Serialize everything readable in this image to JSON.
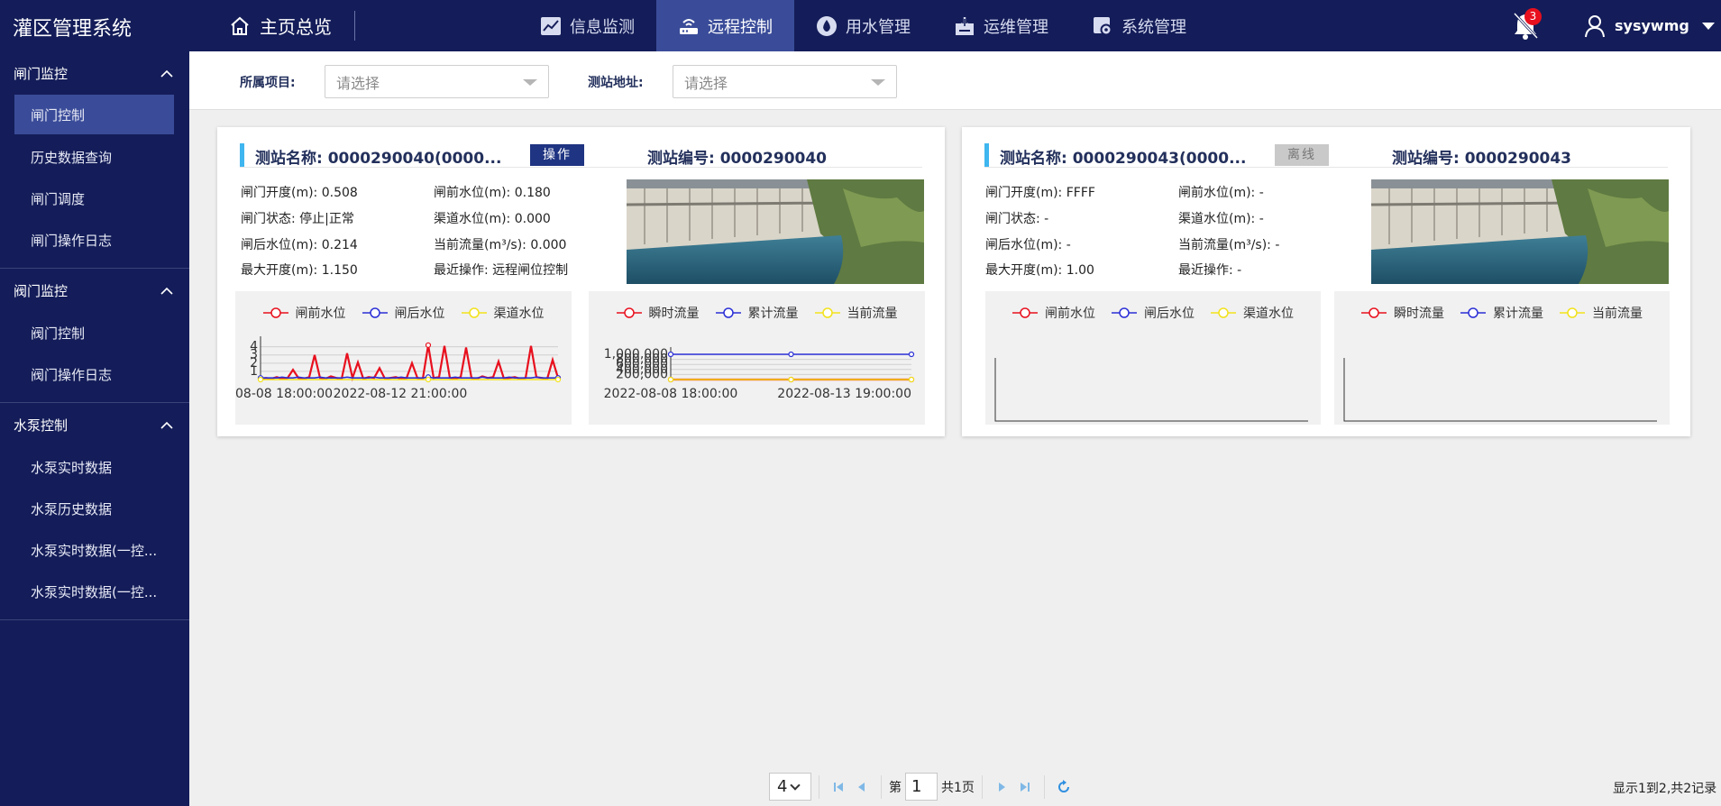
{
  "app": {
    "title": "灌区管理系统",
    "home_label": "主页总览"
  },
  "nav": [
    {
      "label": "信息监测",
      "icon": "chart-line-icon",
      "active": false
    },
    {
      "label": "远程控制",
      "icon": "router-icon",
      "active": true
    },
    {
      "label": "用水管理",
      "icon": "water-drop-icon",
      "active": false
    },
    {
      "label": "运维管理",
      "icon": "maintenance-icon",
      "active": false
    },
    {
      "label": "系统管理",
      "icon": "system-settings-icon",
      "active": false
    }
  ],
  "notifications": {
    "count": "3"
  },
  "user": {
    "name": "sysywmg"
  },
  "sidebar": {
    "groups": [
      {
        "title": "闸门监控",
        "items": [
          "闸门控制",
          "历史数据查询",
          "闸门调度",
          "闸门操作日志"
        ]
      },
      {
        "title": "阀门监控",
        "items": [
          "阀门控制",
          "阀门操作日志"
        ]
      },
      {
        "title": "水泵控制",
        "items": [
          "水泵实时数据",
          "水泵历史数据",
          "水泵实时数据(一控...",
          "水泵实时数据(一控..."
        ]
      }
    ],
    "active_item": "闸门控制"
  },
  "filters": {
    "project_label": "所属项目:",
    "project_placeholder": "请选择",
    "station_label": "测站地址:",
    "station_placeholder": "请选择"
  },
  "cards": [
    {
      "name_label": "测站名称: 0000290040(0000...",
      "button": "操作",
      "online": true,
      "code_label": "测站编号: 0000290040",
      "info": {
        "gate_open": "闸门开度(m): 0.508",
        "front_level": "闸前水位(m): 0.180",
        "gate_status": "闸门状态: 停止|正常",
        "channel_level": "渠道水位(m): 0.000",
        "rear_level": "闸后水位(m): 0.214",
        "flow": "当前流量(m³/s): 0.000",
        "max_open": "最大开度(m): 1.150",
        "last_op": "最近操作: 远程闸位控制"
      },
      "chart1": {
        "legend": [
          "闸前水位",
          "闸后水位",
          "渠道水位"
        ],
        "yticks": [
          "4",
          "3",
          "2",
          "1"
        ],
        "xticks": [
          "08-08 18:00:00",
          "2022-08-12 21:00:00"
        ]
      },
      "chart2": {
        "legend": [
          "瞬时流量",
          "累计流量",
          "当前流量"
        ],
        "yticks": [
          "1,000,000",
          "800,000",
          "600,000",
          "400,000",
          "200,000"
        ],
        "xticks": [
          "2022-08-08 18:00:00",
          "2022-08-13 19:00:00"
        ]
      }
    },
    {
      "name_label": "测站名称: 0000290043(0000...",
      "button": "离线",
      "online": false,
      "code_label": "测站编号: 0000290043",
      "info": {
        "gate_open": "闸门开度(m): FFFF",
        "front_level": "闸前水位(m): -",
        "gate_status": "闸门状态: -",
        "channel_level": "渠道水位(m): -",
        "rear_level": "闸后水位(m): -",
        "flow": "当前流量(m³/s): -",
        "max_open": "最大开度(m): 1.00",
        "last_op": "最近操作: -"
      },
      "chart1": {
        "legend": [
          "闸前水位",
          "闸后水位",
          "渠道水位"
        ]
      },
      "chart2": {
        "legend": [
          "瞬时流量",
          "累计流量",
          "当前流量"
        ]
      }
    }
  ],
  "chart_data": [
    {
      "type": "line",
      "x": [
        "2022-08-08 18:00:00",
        "2022-08-12 21:00:00"
      ],
      "yticks": [
        1,
        2,
        3,
        4
      ],
      "series": [
        {
          "name": "闸前水位",
          "color": "#e8101e",
          "values": [
            0.1,
            0.2,
            0.1,
            0.3,
            0.1,
            0.2,
            1.2,
            0.2,
            0.1,
            0.3,
            3.0,
            0.2,
            0.1,
            0.4,
            0.2,
            0.1,
            3.2,
            0.2,
            2.1,
            0.1,
            0.3,
            0.2,
            1.4,
            0.1,
            0.2,
            0.3,
            0.1,
            0.2,
            2.0,
            0.2,
            0.1,
            4.2,
            0.2,
            0.3,
            4.1,
            0.2,
            0.1,
            0.3,
            3.9,
            0.2,
            0.1,
            0.4,
            0.2,
            0.3,
            2.2,
            0.1,
            0.2,
            0.3,
            0.1,
            0.2,
            4.1,
            0.3,
            0.2,
            0.1,
            2.4,
            0.2
          ]
        },
        {
          "name": "闸后水位",
          "color": "#2b2fd6",
          "values": [
            0.2,
            0.2,
            0.2,
            0.2,
            0.3,
            0.2,
            0.2,
            0.3,
            0.2,
            0.2,
            0.2,
            0.3,
            0.2,
            0.2,
            0.2,
            0.2,
            0.3,
            0.2,
            0.2,
            0.2,
            0.2,
            0.3,
            0.2,
            0.2,
            0.2,
            0.2,
            0.3,
            0.2,
            0.2,
            0.2,
            0.2,
            0.3,
            0.2,
            0.2,
            0.2,
            0.2,
            0.3,
            0.2,
            0.2,
            0.2,
            0.2,
            0.3,
            0.2,
            0.2,
            0.2,
            0.2,
            0.3,
            0.2,
            0.2,
            0.2,
            0.2,
            0.3,
            0.2,
            0.2,
            0.2,
            0.2
          ]
        },
        {
          "name": "渠道水位",
          "color": "#f2e21a",
          "values": [
            0,
            0,
            0,
            0,
            0,
            0,
            0,
            0,
            0,
            0,
            0,
            0,
            0,
            0,
            0,
            0,
            0,
            0,
            0,
            0,
            0,
            0,
            0,
            0,
            0,
            0,
            0,
            0,
            0,
            0,
            0,
            0,
            0,
            0,
            0,
            0,
            0,
            0,
            0,
            0,
            0,
            0,
            0,
            0,
            0,
            0,
            0,
            0,
            0,
            0,
            0,
            0,
            0,
            0,
            0,
            0
          ]
        }
      ]
    },
    {
      "type": "line",
      "x": [
        "2022-08-08 18:00:00",
        "2022-08-13 19:00:00"
      ],
      "yticks": [
        200000,
        400000,
        600000,
        800000,
        1000000
      ],
      "series": [
        {
          "name": "瞬时流量",
          "color": "#e8101e",
          "values": [
            0,
            0,
            0
          ]
        },
        {
          "name": "累计流量",
          "color": "#2b2fd6",
          "values": [
            1000000,
            1000000,
            1000000
          ]
        },
        {
          "name": "当前流量",
          "color": "#f2e21a",
          "values": [
            0,
            0,
            0
          ]
        }
      ]
    }
  ],
  "pager": {
    "size": "4",
    "page_prefix": "第",
    "page": "1",
    "total": "共1页",
    "summary": "显示1到2,共2记录"
  }
}
